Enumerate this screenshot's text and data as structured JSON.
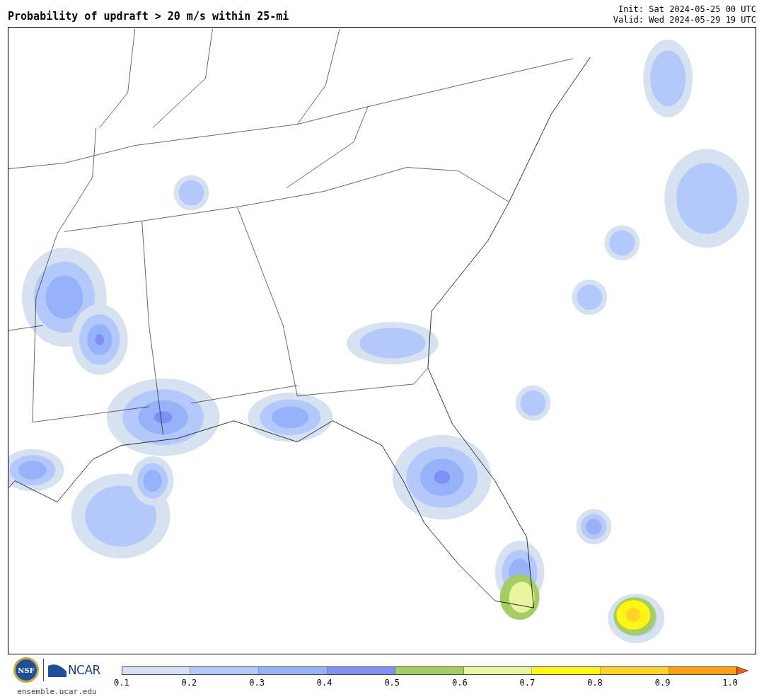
{
  "header": {
    "title": "Probability of updraft > 20 m/s within 25-mi",
    "init": "Init: Sat 2024-05-25 00 UTC",
    "valid": "Valid: Wed 2024-05-29 19 UTC"
  },
  "footer": {
    "nsf_logo": "NSF",
    "ncar_logo": "NCAR",
    "site": "ensemble.ucar.edu"
  },
  "legend": {
    "bins": [
      {
        "color": "#d6e2ef"
      },
      {
        "color": "#b4c8fc"
      },
      {
        "color": "#96b2f8"
      },
      {
        "color": "#7e90f6"
      },
      {
        "color": "#a5cd64"
      },
      {
        "color": "#e8f4a0"
      },
      {
        "color": "#fff514"
      },
      {
        "color": "#ffd22a"
      },
      {
        "color": "#ff9f10"
      }
    ],
    "extend": {
      "color": "#ff5a10"
    },
    "ticks": [
      "0.1",
      "0.2",
      "0.3",
      "0.4",
      "0.5",
      "0.6",
      "0.7",
      "0.8",
      "0.9",
      "1.0"
    ]
  }
}
